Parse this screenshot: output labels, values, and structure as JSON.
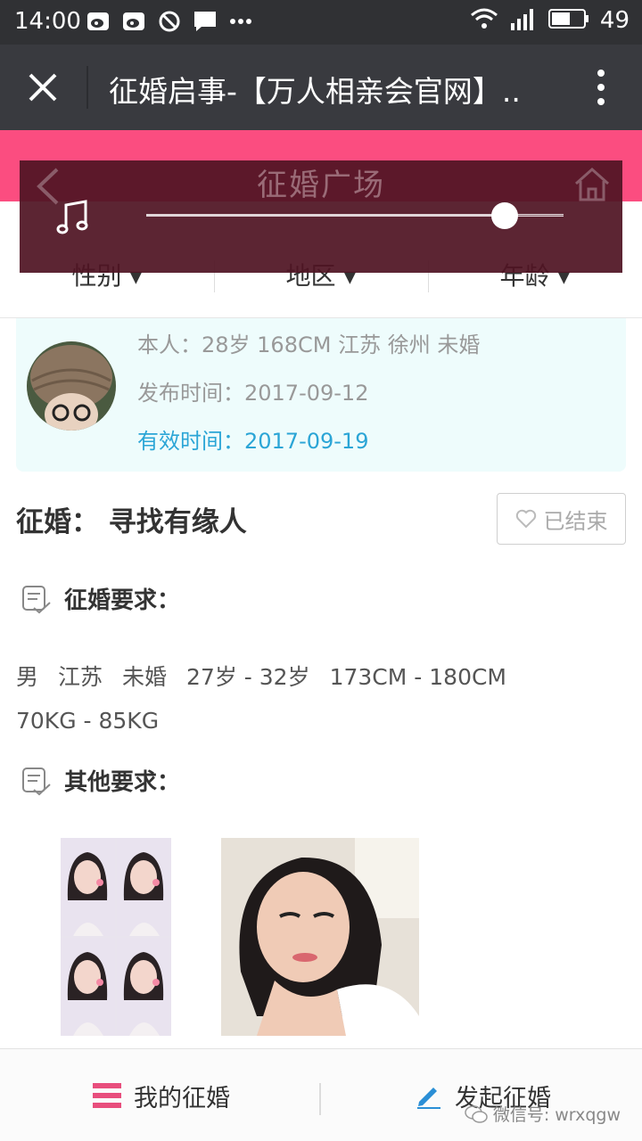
{
  "status_bar": {
    "time": "14:00",
    "battery": "49",
    "icons": [
      "weibo-icon",
      "weibo-icon",
      "dnd-icon",
      "message-icon",
      "more-dots-icon",
      "wifi-icon",
      "signal-icon",
      "battery-icon"
    ]
  },
  "title_bar": {
    "title": "征婚启事-【万人相亲会官网】.."
  },
  "overlay": {
    "page_title": "征婚广场",
    "progress": 0.86
  },
  "filters": [
    {
      "label": "性别"
    },
    {
      "label": "地区"
    },
    {
      "label": "年龄"
    }
  ],
  "profile": {
    "self_info": "本人：28岁 168CM 江苏 徐州 未婚",
    "publish_time": "发布时间：2017-09-12",
    "valid_time": "有效时间：2017-09-19"
  },
  "post": {
    "headline": "征婚：  寻找有缘人",
    "status_button": "已结束"
  },
  "requirements": {
    "title": "征婚要求：",
    "items_line1": [
      "男",
      "江苏",
      "未婚",
      "27岁 - 32岁",
      "173CM - 180CM"
    ],
    "items_line2": [
      "70KG - 85KG"
    ]
  },
  "other": {
    "title": "其他要求："
  },
  "bottom_bar": {
    "my_marriage": "我的征婚",
    "start_marriage": "发起征婚"
  },
  "watermark": "微信号: wrxqgw",
  "colors": {
    "brand_pink": "#fb4d80",
    "valid_blue": "#2ba5d6",
    "menu_icon_pink": "#e84e7d",
    "edit_icon_blue": "#2b8fd6"
  }
}
